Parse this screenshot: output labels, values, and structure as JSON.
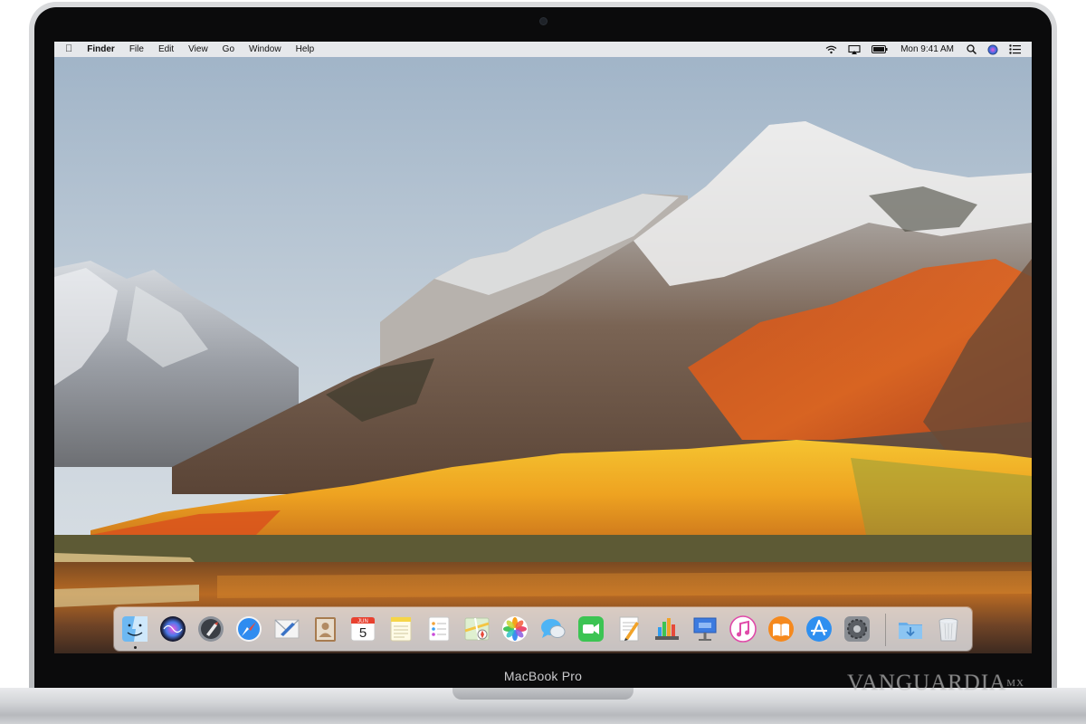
{
  "menubar": {
    "apple_icon": "apple-logo-icon",
    "app_name": "Finder",
    "menus": [
      "File",
      "Edit",
      "View",
      "Go",
      "Window",
      "Help"
    ],
    "status_icons": [
      "wifi-icon",
      "airplay-icon",
      "battery-icon"
    ],
    "clock": "Mon 9:41 AM",
    "right_icons": [
      "spotlight-search-icon",
      "siri-icon",
      "notification-center-icon"
    ]
  },
  "dock": {
    "apps": [
      {
        "name": "Finder",
        "icon": "finder-icon"
      },
      {
        "name": "Siri",
        "icon": "siri-icon"
      },
      {
        "name": "Launchpad",
        "icon": "launchpad-icon"
      },
      {
        "name": "Safari",
        "icon": "safari-icon"
      },
      {
        "name": "Mail",
        "icon": "mail-icon"
      },
      {
        "name": "Contacts",
        "icon": "contacts-icon"
      },
      {
        "name": "Calendar",
        "icon": "calendar-icon",
        "month": "JUN",
        "day": "5"
      },
      {
        "name": "Notes",
        "icon": "notes-icon"
      },
      {
        "name": "Reminders",
        "icon": "reminders-icon"
      },
      {
        "name": "Maps",
        "icon": "maps-icon"
      },
      {
        "name": "Photos",
        "icon": "photos-icon"
      },
      {
        "name": "Messages",
        "icon": "messages-icon"
      },
      {
        "name": "FaceTime",
        "icon": "facetime-icon"
      },
      {
        "name": "Pages",
        "icon": "pages-icon"
      },
      {
        "name": "Numbers",
        "icon": "numbers-icon"
      },
      {
        "name": "Keynote",
        "icon": "keynote-icon"
      },
      {
        "name": "iTunes",
        "icon": "itunes-icon"
      },
      {
        "name": "iBooks",
        "icon": "ibooks-icon"
      },
      {
        "name": "App Store",
        "icon": "app-store-icon"
      },
      {
        "name": "System Preferences",
        "icon": "system-preferences-icon"
      }
    ],
    "others": [
      {
        "name": "Downloads",
        "icon": "downloads-folder-icon"
      },
      {
        "name": "Trash",
        "icon": "trash-icon"
      }
    ]
  },
  "hardware": {
    "brand_label": "MacBook Pro"
  },
  "watermark": {
    "text": "VANGUARDIA",
    "mark": "MX"
  },
  "colors": {
    "sky": "#a9bccd",
    "foliage_orange": "#e2581c",
    "foliage_yellow": "#f1b629",
    "menubar": "#ececee"
  }
}
